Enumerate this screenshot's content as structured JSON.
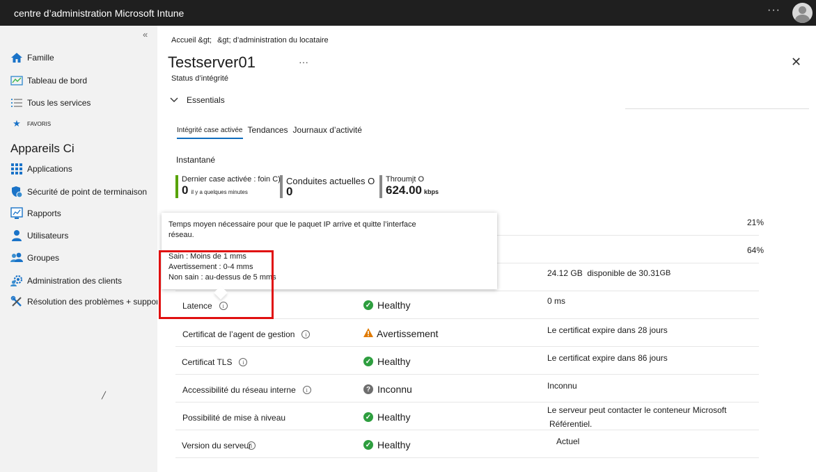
{
  "header": {
    "app_title": "centre d’administration Microsoft Intune",
    "more": "···"
  },
  "sidebar": {
    "collapse": "«",
    "items": [
      {
        "label": "Famille",
        "icon": "home-icon"
      },
      {
        "label": "Tableau de bord",
        "icon": "dashboard-icon"
      },
      {
        "label": "Tous les services",
        "icon": "list-icon"
      },
      {
        "label": "FAVORIS",
        "icon": "star-icon"
      }
    ],
    "section_title": "Appareils Ci",
    "section_items": [
      {
        "label": "Applications",
        "icon": "apps-grid-icon"
      },
      {
        "label": "Sécurité de point de terminaison",
        "icon": "shield-icon"
      },
      {
        "label": "Rapports",
        "icon": "reports-icon"
      },
      {
        "label": "Utilisateurs",
        "icon": "user-icon"
      },
      {
        "label": "Groupes",
        "icon": "group-icon"
      },
      {
        "label": "Administration des clients",
        "icon": "gear-user-icon"
      },
      {
        "label": "Résolution des problèmes + support",
        "icon": "wrench-icon"
      }
    ]
  },
  "breadcrumb": [
    "Accueil &gt;",
    "&gt; d’administration du locataire"
  ],
  "page": {
    "title": "Testserver01",
    "title_more": "···",
    "subtitle": "Status d’intégrité",
    "essentials": "Essentials",
    "close": "✕"
  },
  "tabs": [
    "Intégrité case activée",
    "Tendances",
    "Journaux d’activité"
  ],
  "snapshot": {
    "label": "Instantané",
    "metrics": [
      {
        "label": "Dernier case activée : foin C)",
        "value": "0",
        "sub": "il y a quelques minutes"
      },
      {
        "label": "Conduites actuelles O",
        "value": "0"
      },
      {
        "label": "Throumjt O",
        "value": "624.00",
        "unit": "kbps"
      }
    ]
  },
  "tooltip": {
    "description": "Temps moyen nécessaire pour que le paquet IP arrive et quitte l’interface réseau.",
    "levels": [
      "Sain : Moins de 1 mms",
      "Avertissement : 0-4 mms",
      "Non sain : au-dessus de 5 mms"
    ]
  },
  "hidden_rows": {
    "row1_pct": "21%",
    "row2_pct": "64%",
    "row3_value": "24.12 GB",
    "row3_detail": "disponible de 30.31",
    "row3_unit": "GB"
  },
  "rows": [
    {
      "name": "Latence",
      "status": "Healthy",
      "status_type": "ok",
      "detail": "0 ms"
    },
    {
      "name": "Certificat de l’agent de gestion",
      "status": "Avertissement",
      "status_type": "warning",
      "detail": "Le certificat expire dans 28 jours"
    },
    {
      "name": "Certificat TLS",
      "status": "Healthy",
      "status_type": "ok",
      "detail": "Le certificat expire dans 86 jours"
    },
    {
      "name": "Accessibilité du réseau interne",
      "status": "Inconnu",
      "status_type": "unknown",
      "detail": "Inconnu"
    },
    {
      "name": "Possibilité de mise à niveau",
      "status": "Healthy",
      "status_type": "ok",
      "detail": "Le serveur peut contacter le conteneur Microsoft",
      "detail2": "Référentiel."
    },
    {
      "name": "Version du serveur",
      "status": "Healthy",
      "status_type": "ok",
      "detail": "Actuel"
    }
  ],
  "colors": {
    "accent": "#0f6cbd",
    "healthy": "#2e9e3f",
    "warning": "#e07a00",
    "highlight": "#e01010"
  }
}
